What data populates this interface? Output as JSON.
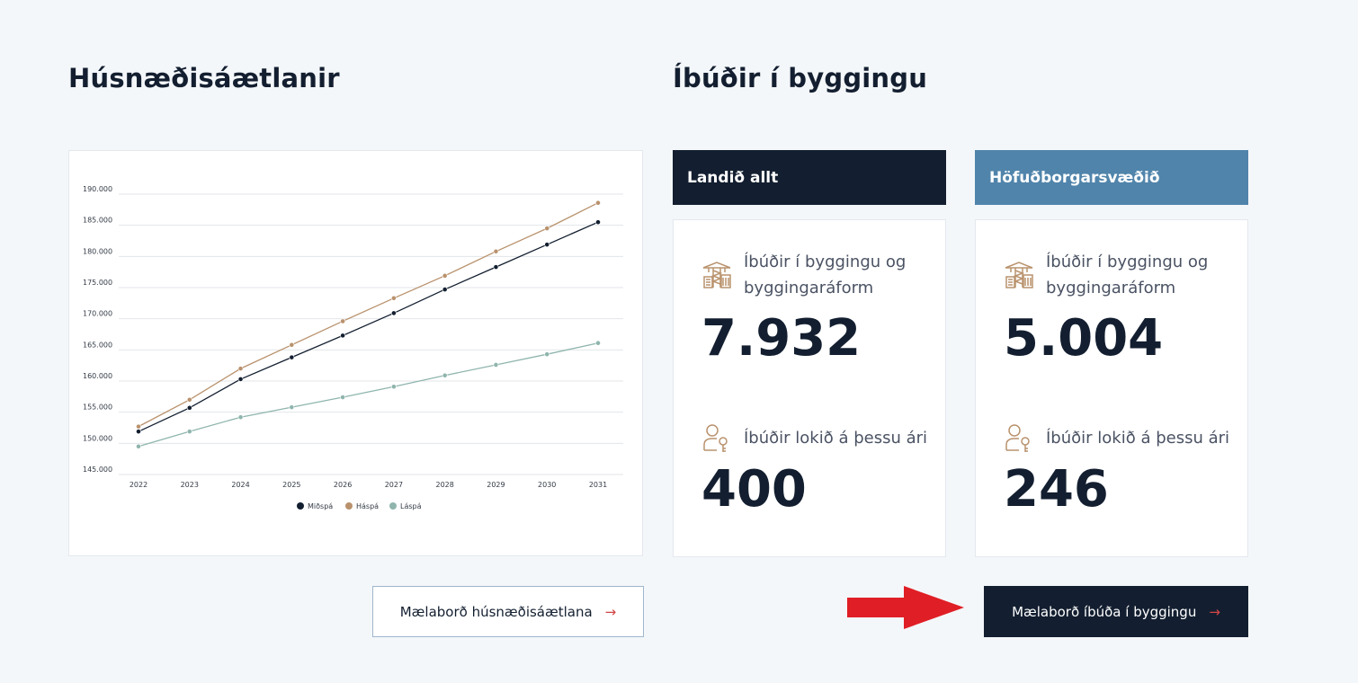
{
  "headings": {
    "plans": "Húsnæðisáætlanir",
    "construction": "Íbúðir í byggingu"
  },
  "colors": {
    "navy": "#131f30",
    "steel_blue": "#5084ab",
    "tan": "#b9926d",
    "sage": "#8fb5ad",
    "arrow_red": "#e01e25",
    "button_arrow": "#d24646"
  },
  "regions": [
    {
      "tab_label": "Landið allt",
      "under_construction_label": "Íbúðir í byggingu og byggingaráform",
      "under_construction_value": "7.932",
      "completed_label": "Íbúðir lokið á þessu ári",
      "completed_value": "400",
      "icons": [
        "building-crane-icon",
        "person-key-icon"
      ]
    },
    {
      "tab_label": "Höfuðborgarsvæðið",
      "under_construction_label": "Íbúðir í byggingu og byggingaráform",
      "under_construction_value": "5.004",
      "completed_label": "Íbúðir lokið á þessu ári",
      "completed_value": "246",
      "icons": [
        "building-crane-icon",
        "person-key-icon"
      ]
    }
  ],
  "buttons": {
    "plans_dashboard": "Mælaborð húsnæðisáætlana",
    "construction_dashboard": "Mælaborð íbúða í byggingu",
    "arrow_glyph": "→"
  },
  "chart_data": {
    "type": "line",
    "x": [
      "2022",
      "2023",
      "2024",
      "2025",
      "2026",
      "2027",
      "2028",
      "2029",
      "2030",
      "2031"
    ],
    "y_ticks": [
      "145.000",
      "150.000",
      "155.000",
      "160.000",
      "165.000",
      "170.000",
      "175.000",
      "180.000",
      "185.000",
      "190.000"
    ],
    "ylim": [
      145000,
      190000
    ],
    "grid": true,
    "legend_position": "bottom-center",
    "series": [
      {
        "name": "Miðspá",
        "color": "#131f30",
        "values": [
          151900,
          155700,
          160300,
          163800,
          167300,
          170900,
          174700,
          178300,
          181900,
          185500
        ]
      },
      {
        "name": "Háspá",
        "color": "#b9926d",
        "values": [
          152700,
          157000,
          162000,
          165800,
          169600,
          173300,
          176900,
          180800,
          184500,
          188600
        ]
      },
      {
        "name": "Láspá",
        "color": "#8fb5ad",
        "values": [
          149500,
          151900,
          154200,
          155800,
          157400,
          159100,
          160900,
          162600,
          164300,
          166100
        ]
      }
    ]
  }
}
